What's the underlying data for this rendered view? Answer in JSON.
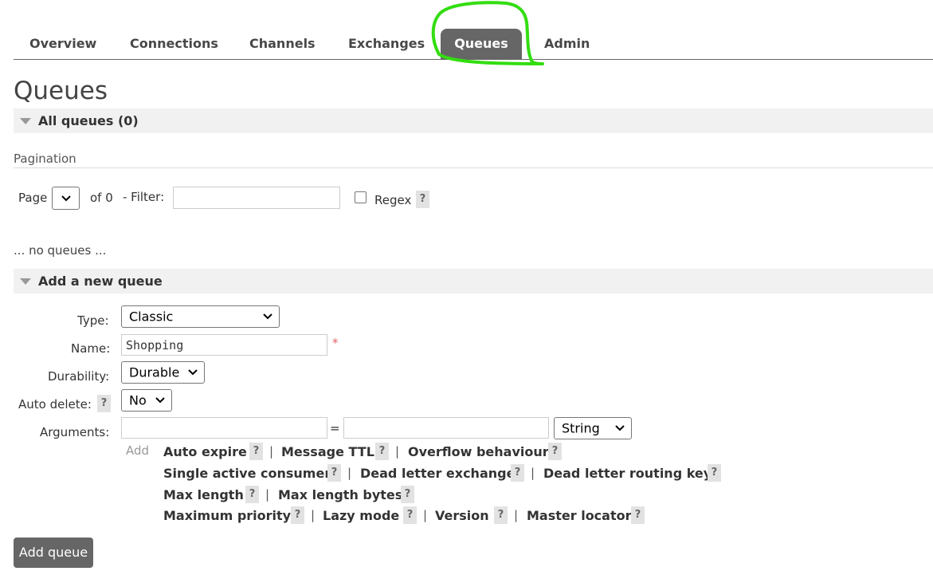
{
  "nav": {
    "tabs": [
      {
        "label": "Overview"
      },
      {
        "label": "Connections"
      },
      {
        "label": "Channels"
      },
      {
        "label": "Exchanges"
      },
      {
        "label": "Queues",
        "active": true
      },
      {
        "label": "Admin"
      }
    ]
  },
  "page": {
    "title": "Queues"
  },
  "all_queues": {
    "header": "All queues (0)"
  },
  "pagination": {
    "title": "Pagination",
    "page_label": "Page",
    "of_label": "of 0",
    "filter_label": "- Filter:",
    "filter_value": "",
    "regex_label": "Regex",
    "regex_help": "?",
    "regex_checked": false
  },
  "empty_text": "... no queues ...",
  "add_queue": {
    "header": "Add a new queue",
    "type_label": "Type:",
    "type_value": "Classic",
    "name_label": "Name:",
    "name_value": "Shopping",
    "required_mark": "*",
    "durability_label": "Durability:",
    "durability_value": "Durable",
    "auto_delete_label": "Auto delete:",
    "auto_delete_help": "?",
    "auto_delete_value": "No",
    "arguments_label": "Arguments:",
    "arg_key_value": "",
    "equals": "=",
    "arg_value": "",
    "arg_type_value": "String",
    "add_label": "Add",
    "arg_links": [
      {
        "label": "Auto expire"
      },
      {
        "label": "Message TTL"
      },
      {
        "label": "Overflow behaviour"
      },
      {
        "label": "Single active consumer"
      },
      {
        "label": "Dead letter exchange"
      },
      {
        "label": "Dead letter routing key"
      },
      {
        "label": "Max length"
      },
      {
        "label": "Max length bytes"
      },
      {
        "label": "Maximum priority"
      },
      {
        "label": "Lazy mode"
      },
      {
        "label": "Version"
      },
      {
        "label": "Master locator"
      }
    ],
    "help_mark": "?",
    "separator": "|",
    "submit_label": "Add queue"
  },
  "colors": {
    "active_tab_bg": "#666666",
    "annotation_circle": "#33dd11",
    "section_bar_bg": "#f1f1f1",
    "required_mark": "#e06666"
  }
}
